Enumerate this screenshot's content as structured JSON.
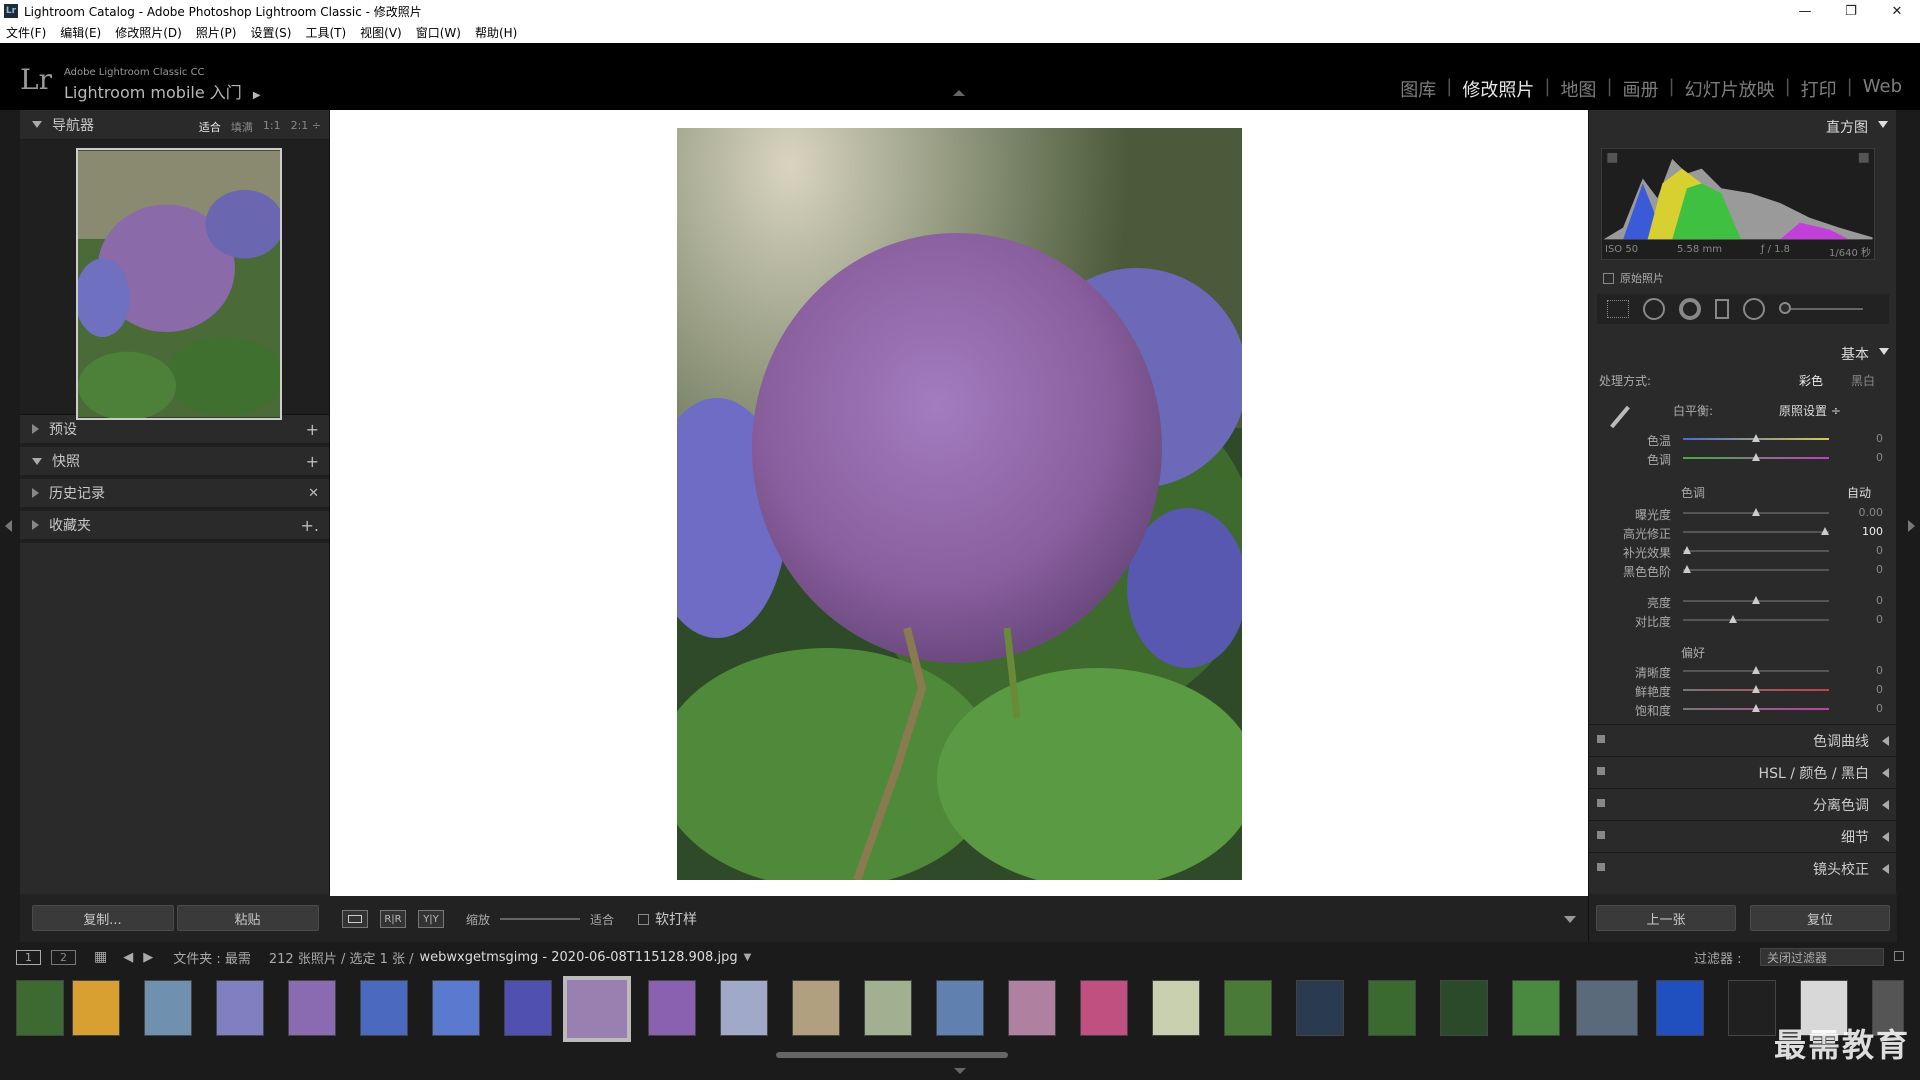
{
  "window": {
    "title": "Lightroom Catalog - Adobe Photoshop Lightroom Classic - 修改照片",
    "app_icon": "Lr",
    "controls": [
      "—",
      "❐",
      "✕"
    ]
  },
  "menu": [
    "文件(F)",
    "编辑(E)",
    "修改照片(D)",
    "照片(P)",
    "设置(S)",
    "工具(T)",
    "视图(V)",
    "窗口(W)",
    "帮助(H)"
  ],
  "brand": {
    "logo": "Lr",
    "small": "Adobe Lightroom Classic CC",
    "big": "Lightroom mobile 入门",
    "arrow": "▶"
  },
  "modules": [
    {
      "label": "图库",
      "active": false
    },
    {
      "label": "修改照片",
      "active": true
    },
    {
      "label": "地图",
      "active": false
    },
    {
      "label": "画册",
      "active": false
    },
    {
      "label": "幻灯片放映",
      "active": false
    },
    {
      "label": "打印",
      "active": false
    },
    {
      "label": "Web",
      "active": false
    }
  ],
  "left": {
    "navigator": "导航器",
    "nav_opts": [
      "适合",
      "填满",
      "1:1",
      "2:1 ÷"
    ],
    "panels": [
      {
        "label": "预设",
        "action": "+"
      },
      {
        "label": "快照",
        "action": "+"
      },
      {
        "label": "历史记录",
        "action": "✕"
      },
      {
        "label": "收藏夹",
        "action": "+."
      }
    ],
    "copy": "复制...",
    "paste": "粘贴"
  },
  "toolbar": {
    "zoom_label": "缩放",
    "zoom_value": "适合",
    "softproof": "软打样",
    "view_ico": [
      "",
      "R|R",
      "Y|Y"
    ]
  },
  "right": {
    "histogram": "直方图",
    "exif": [
      "ISO 50",
      "5.58 mm",
      "ƒ / 1.8",
      "1/640 秒"
    ],
    "original": "原始照片",
    "basic": "基本",
    "treatment_label": "处理方式:",
    "color": "彩色",
    "bw": "黑白",
    "wb_label": "白平衡:",
    "wb_value": "原照设置 ÷",
    "tone_label": "色调",
    "auto": "自动",
    "presence": "偏好",
    "sliders": {
      "temp": {
        "label": "色温",
        "value": "0",
        "pos": 0.5
      },
      "tint": {
        "label": "色调",
        "value": "0",
        "pos": 0.5
      },
      "exposure": {
        "label": "曝光度",
        "value": "0.00",
        "pos": 0.5
      },
      "highlights": {
        "label": "高光修正",
        "value": "100",
        "pos": 0.97
      },
      "fill": {
        "label": "补光效果",
        "value": "0",
        "pos": 0.03
      },
      "blacks": {
        "label": "黑色色阶",
        "value": "0",
        "pos": 0.03
      },
      "brightness": {
        "label": "亮度",
        "value": "0",
        "pos": 0.5
      },
      "contrast": {
        "label": "对比度",
        "value": "0",
        "pos": 0.34
      },
      "clarity": {
        "label": "清晰度",
        "value": "0",
        "pos": 0.5
      },
      "vibrance": {
        "label": "鲜艳度",
        "value": "0",
        "pos": 0.5
      },
      "saturation": {
        "label": "饱和度",
        "value": "0",
        "pos": 0.5
      }
    },
    "collapsed": [
      {
        "label": "色调曲线"
      },
      {
        "label": "HSL  /  颜色  /  黑白"
      },
      {
        "label": "分离色调"
      },
      {
        "label": "细节"
      },
      {
        "label": "镜头校正"
      }
    ],
    "prev": "上一张",
    "reset": "复位"
  },
  "filmstrip": {
    "view1": "1",
    "view2": "2",
    "path": "文件夹 : 最需",
    "count": "212 张照片 / 选定 1 张 /",
    "filename": "webwxgetmsgimg - 2020-06-08T115128.908.jpg",
    "filter_label": "过滤器 :",
    "filter_value": "关闭过滤器"
  },
  "watermark": "最需教育"
}
